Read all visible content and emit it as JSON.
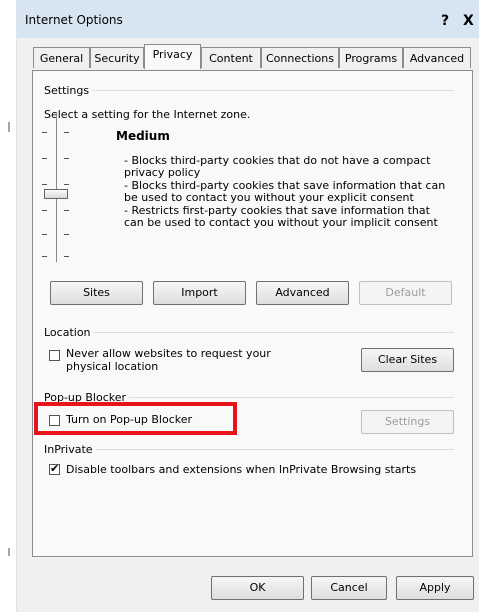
{
  "window": {
    "title": "Internet Options",
    "help_label": "?",
    "close_label": "X"
  },
  "tabs": [
    {
      "label": "General",
      "active": false
    },
    {
      "label": "Security",
      "active": false
    },
    {
      "label": "Privacy",
      "active": true
    },
    {
      "label": "Content",
      "active": false
    },
    {
      "label": "Connections",
      "active": false
    },
    {
      "label": "Programs",
      "active": false
    },
    {
      "label": "Advanced",
      "active": false
    }
  ],
  "settings": {
    "group_label": "Settings",
    "instruction": "Select a setting for the Internet zone.",
    "level_title": "Medium",
    "descriptions": [
      "- Blocks third-party cookies that do not have a compact",
      "privacy policy",
      "- Blocks third-party cookies that save information that can",
      "be used to contact you without your explicit consent",
      "- Restricts first-party cookies that save information that",
      "can be used to contact you without your implicit consent"
    ],
    "buttons": {
      "sites": "Sites",
      "import": "Import",
      "advanced": "Advanced",
      "default": "Default"
    }
  },
  "location": {
    "group_label": "Location",
    "checkbox_label_line1": "Never allow websites to request your",
    "checkbox_label_line2": "physical location",
    "checked": false,
    "clear_sites": "Clear Sites"
  },
  "popup": {
    "group_label": "Pop-up Blocker",
    "checkbox_label": "Turn on Pop-up Blocker",
    "checked": false,
    "settings_button": "Settings"
  },
  "inprivate": {
    "group_label": "InPrivate",
    "checkbox_label": "Disable toolbars and extensions when InPrivate Browsing starts",
    "checked": true,
    "check_glyph": "✔"
  },
  "footer": {
    "ok": "OK",
    "cancel": "Cancel",
    "apply": "Apply"
  },
  "colors": {
    "titlebar": "#d7e4f2",
    "highlight": "#e8131b"
  }
}
